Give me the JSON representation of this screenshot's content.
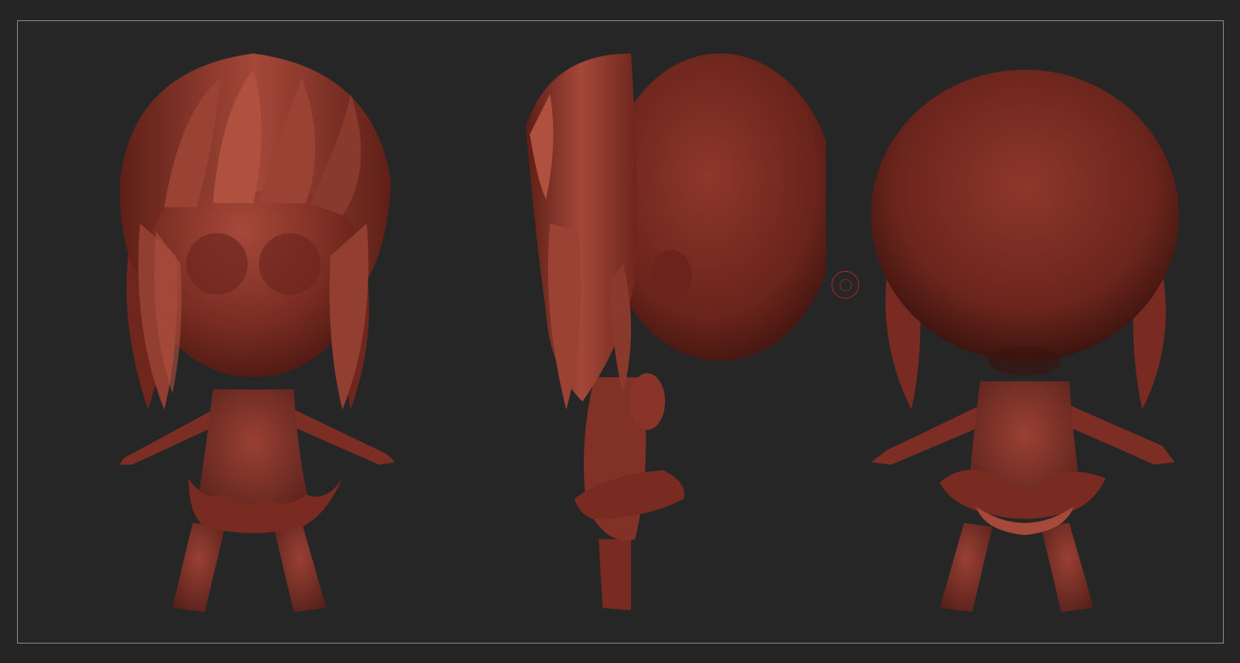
{
  "app": {
    "window_title": ""
  },
  "colors": {
    "background": "#252525",
    "viewport_border": "#8a8a8a",
    "material_base": "#8a3427",
    "material_light": "#a9493a",
    "material_dark": "#4e1a13",
    "cursor": "#b0272a"
  },
  "views": [
    {
      "name": "front"
    },
    {
      "name": "side"
    },
    {
      "name": "back"
    }
  ],
  "icons": {
    "brush_cursor": "brush-cursor-icon"
  }
}
